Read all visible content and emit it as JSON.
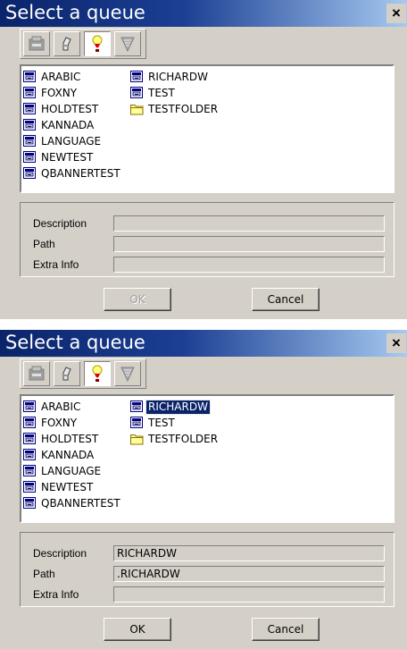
{
  "colors": {
    "titlebar_start": "#0a246a",
    "titlebar_end": "#a6caf0",
    "face": "#d4d0c8",
    "selection": "#0a246a"
  },
  "toolbar_icons": [
    "queue-properties-icon",
    "find-printer-icon",
    "lightbulb-icon",
    "network-tree-icon"
  ],
  "dialogs": [
    {
      "title": "Select a queue",
      "close_label": "×",
      "queues_col1": [
        {
          "label": "ARABIC",
          "icon": "printer-queue-icon"
        },
        {
          "label": "FOXNY",
          "icon": "printer-queue-icon"
        },
        {
          "label": "HOLDTEST",
          "icon": "printer-queue-icon"
        },
        {
          "label": "KANNADA",
          "icon": "printer-queue-icon"
        },
        {
          "label": "LANGUAGE",
          "icon": "printer-queue-icon"
        },
        {
          "label": "NEWTEST",
          "icon": "printer-queue-icon"
        },
        {
          "label": "QBANNERTEST",
          "icon": "printer-queue-icon"
        }
      ],
      "queues_col2": [
        {
          "label": "RICHARDW",
          "icon": "printer-queue-icon"
        },
        {
          "label": "TEST",
          "icon": "printer-queue-icon"
        },
        {
          "label": "TESTFOLDER",
          "icon": "folder-icon"
        }
      ],
      "selected": null,
      "description_label": "Description",
      "path_label": "Path",
      "extra_label": "Extra Info",
      "description_value": "",
      "path_value": "",
      "extra_value": "",
      "ok_label": "OK",
      "ok_enabled": false,
      "cancel_label": "Cancel"
    },
    {
      "title": "Select a queue",
      "close_label": "×",
      "queues_col1": [
        {
          "label": "ARABIC",
          "icon": "printer-queue-icon"
        },
        {
          "label": "FOXNY",
          "icon": "printer-queue-icon"
        },
        {
          "label": "HOLDTEST",
          "icon": "printer-queue-icon"
        },
        {
          "label": "KANNADA",
          "icon": "printer-queue-icon"
        },
        {
          "label": "LANGUAGE",
          "icon": "printer-queue-icon"
        },
        {
          "label": "NEWTEST",
          "icon": "printer-queue-icon"
        },
        {
          "label": "QBANNERTEST",
          "icon": "printer-queue-icon"
        }
      ],
      "queues_col2": [
        {
          "label": "RICHARDW",
          "icon": "printer-queue-icon"
        },
        {
          "label": "TEST",
          "icon": "printer-queue-icon"
        },
        {
          "label": "TESTFOLDER",
          "icon": "folder-icon"
        }
      ],
      "selected": "RICHARDW",
      "description_label": "Description",
      "path_label": "Path",
      "extra_label": "Extra Info",
      "description_value": "RICHARDW",
      "path_value": ".RICHARDW",
      "extra_value": "",
      "ok_label": "OK",
      "ok_enabled": true,
      "cancel_label": "Cancel"
    }
  ]
}
